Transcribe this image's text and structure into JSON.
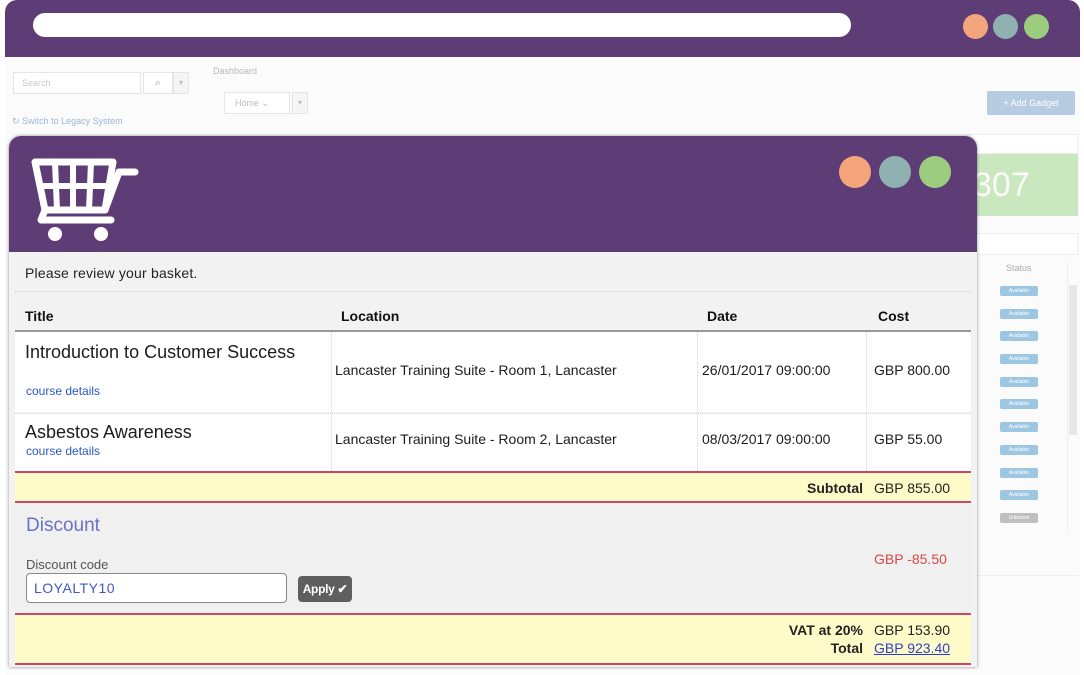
{
  "background_app": {
    "search_placeholder": "Search",
    "legacy_link": "Switch to Legacy System",
    "breadcrumb": "Dashboard",
    "home_select": "Home",
    "add_gadget_label": "+ Add Gadget",
    "stat_value": "307",
    "status_header": "Status",
    "status_badges": [
      "Available",
      "Available",
      "Available",
      "Available",
      "Available",
      "Available",
      "Available",
      "Available",
      "Available",
      "Available",
      "Unknown"
    ]
  },
  "basket": {
    "intro": "Please review your basket.",
    "columns": [
      "Title",
      "Location",
      "Date",
      "Cost"
    ],
    "items": [
      {
        "title": "Introduction to Customer Success",
        "link": "course details",
        "location": "Lancaster Training Suite - Room 1, Lancaster",
        "date": "26/01/2017 09:00:00",
        "cost": "GBP 800.00"
      },
      {
        "title": "Asbestos Awareness",
        "link": "course details",
        "location": "Lancaster Training Suite - Room 2, Lancaster",
        "date": "08/03/2017 09:00:00",
        "cost": "GBP 55.00"
      }
    ],
    "subtotal_label": "Subtotal",
    "subtotal_value": "GBP 855.00",
    "discount": {
      "title": "Discount",
      "code_label": "Discount code",
      "code_value": "LOYALTY10",
      "apply_label": "Apply ✔",
      "amount": "GBP -85.50"
    },
    "vat_label": "VAT at 20%",
    "vat_value": "GBP 153.90",
    "total_label": "Total",
    "total_value": "GBP 923.40"
  },
  "colors": {
    "header_purple": "#5e3d76",
    "dot_orange": "#f5a57c",
    "dot_teal": "#8fb1b0",
    "dot_green": "#9ccc7e",
    "band_yellow": "#fffbc8",
    "band_border": "#c44a66",
    "discount_red": "#d84646",
    "link_blue": "#2b57c5"
  },
  "icons": [
    "shopping-cart-icon",
    "search-icon",
    "sync-icon",
    "chevron-down-icon",
    "check-icon"
  ]
}
